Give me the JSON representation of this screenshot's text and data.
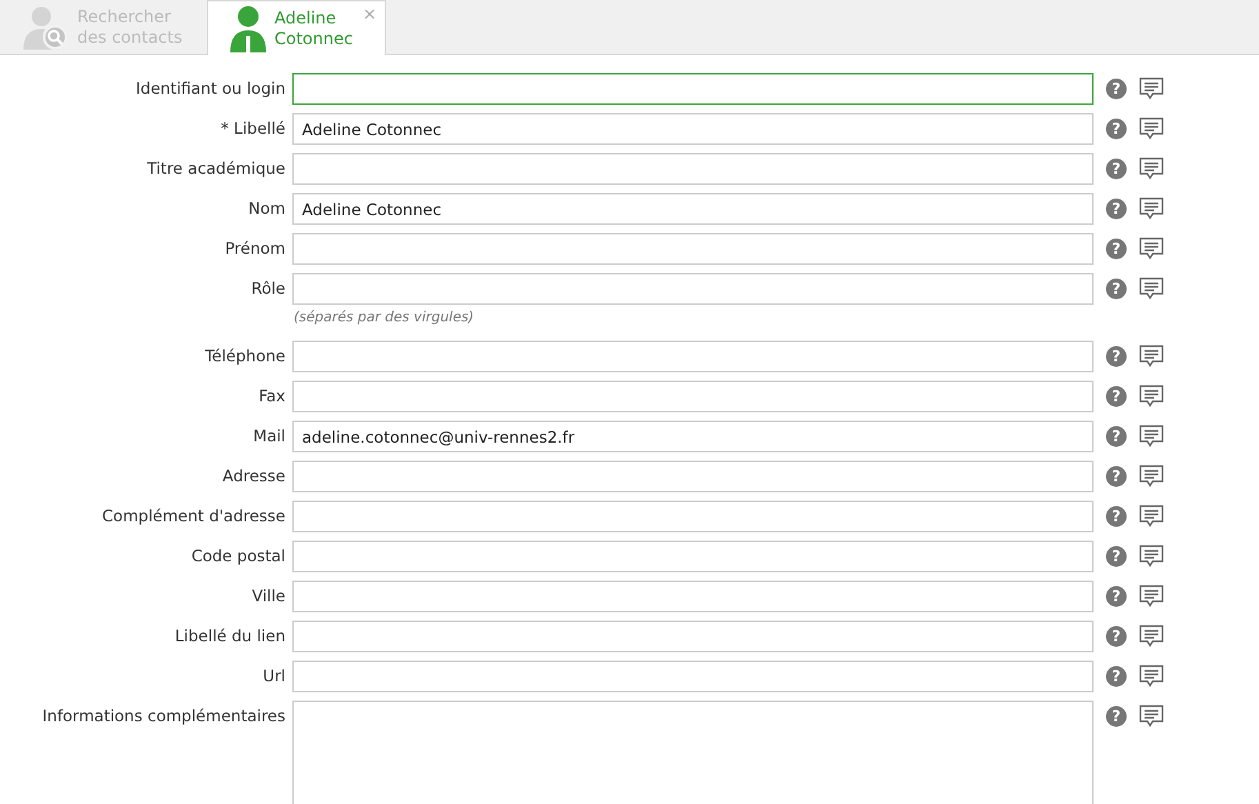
{
  "tabs": [
    {
      "kind": "search",
      "label": "Rechercher des contacts",
      "selected": false
    },
    {
      "kind": "contact",
      "label": "Adeline Cotonnec",
      "selected": true,
      "close": "×"
    }
  ],
  "fields": [
    {
      "kind": "text",
      "label": "Identifiant ou login",
      "focused": true,
      "help": "?"
    },
    {
      "kind": "text",
      "label": "* Libellé",
      "value": "Adeline Cotonnec",
      "focused": false,
      "help": "?"
    },
    {
      "kind": "text",
      "label": "Titre académique",
      "focused": false,
      "help": "?"
    },
    {
      "kind": "text",
      "label": "Nom",
      "value": "Adeline Cotonnec",
      "focused": false,
      "help": "?"
    },
    {
      "kind": "text",
      "label": "Prénom",
      "focused": false,
      "help": "?"
    },
    {
      "kind": "text",
      "label": "Rôle",
      "focused": false,
      "help": "?",
      "hint": "(séparés par des virgules)"
    },
    {
      "kind": "text",
      "label": "Téléphone",
      "focused": false,
      "help": "?"
    },
    {
      "kind": "text",
      "label": "Fax",
      "focused": false,
      "help": "?"
    },
    {
      "kind": "text",
      "label": "Mail",
      "value": "adeline.cotonnec@univ-rennes2.fr",
      "focused": false,
      "help": "?"
    },
    {
      "kind": "text",
      "label": "Adresse",
      "focused": false,
      "help": "?"
    },
    {
      "kind": "text",
      "label": "Complément d'adresse",
      "focused": false,
      "help": "?"
    },
    {
      "kind": "text",
      "label": "Code postal",
      "focused": false,
      "help": "?"
    },
    {
      "kind": "text",
      "label": "Ville",
      "focused": false,
      "help": "?"
    },
    {
      "kind": "text",
      "label": "Libellé du lien",
      "focused": false,
      "help": "?"
    },
    {
      "kind": "text",
      "label": "Url",
      "focused": false,
      "help": "?"
    },
    {
      "kind": "textarea",
      "label": "Informations complémentaires",
      "focused": false,
      "help": "?"
    }
  ]
}
